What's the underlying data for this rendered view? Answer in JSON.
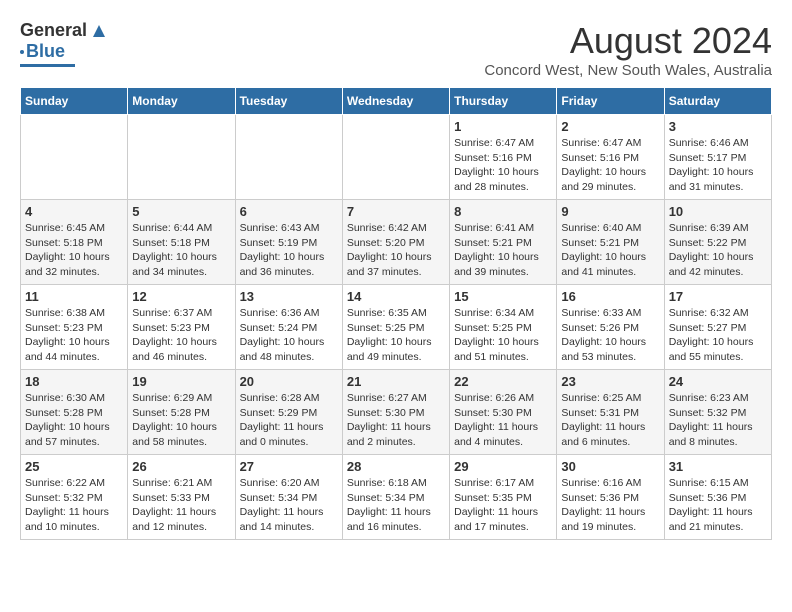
{
  "logo": {
    "general": "General",
    "blue": "Blue"
  },
  "title": {
    "month_year": "August 2024",
    "location": "Concord West, New South Wales, Australia"
  },
  "days_header": [
    "Sunday",
    "Monday",
    "Tuesday",
    "Wednesday",
    "Thursday",
    "Friday",
    "Saturday"
  ],
  "weeks": [
    [
      {
        "day": "",
        "info": ""
      },
      {
        "day": "",
        "info": ""
      },
      {
        "day": "",
        "info": ""
      },
      {
        "day": "",
        "info": ""
      },
      {
        "day": "1",
        "info": "Sunrise: 6:47 AM\nSunset: 5:16 PM\nDaylight: 10 hours\nand 28 minutes."
      },
      {
        "day": "2",
        "info": "Sunrise: 6:47 AM\nSunset: 5:16 PM\nDaylight: 10 hours\nand 29 minutes."
      },
      {
        "day": "3",
        "info": "Sunrise: 6:46 AM\nSunset: 5:17 PM\nDaylight: 10 hours\nand 31 minutes."
      }
    ],
    [
      {
        "day": "4",
        "info": "Sunrise: 6:45 AM\nSunset: 5:18 PM\nDaylight: 10 hours\nand 32 minutes."
      },
      {
        "day": "5",
        "info": "Sunrise: 6:44 AM\nSunset: 5:18 PM\nDaylight: 10 hours\nand 34 minutes."
      },
      {
        "day": "6",
        "info": "Sunrise: 6:43 AM\nSunset: 5:19 PM\nDaylight: 10 hours\nand 36 minutes."
      },
      {
        "day": "7",
        "info": "Sunrise: 6:42 AM\nSunset: 5:20 PM\nDaylight: 10 hours\nand 37 minutes."
      },
      {
        "day": "8",
        "info": "Sunrise: 6:41 AM\nSunset: 5:21 PM\nDaylight: 10 hours\nand 39 minutes."
      },
      {
        "day": "9",
        "info": "Sunrise: 6:40 AM\nSunset: 5:21 PM\nDaylight: 10 hours\nand 41 minutes."
      },
      {
        "day": "10",
        "info": "Sunrise: 6:39 AM\nSunset: 5:22 PM\nDaylight: 10 hours\nand 42 minutes."
      }
    ],
    [
      {
        "day": "11",
        "info": "Sunrise: 6:38 AM\nSunset: 5:23 PM\nDaylight: 10 hours\nand 44 minutes."
      },
      {
        "day": "12",
        "info": "Sunrise: 6:37 AM\nSunset: 5:23 PM\nDaylight: 10 hours\nand 46 minutes."
      },
      {
        "day": "13",
        "info": "Sunrise: 6:36 AM\nSunset: 5:24 PM\nDaylight: 10 hours\nand 48 minutes."
      },
      {
        "day": "14",
        "info": "Sunrise: 6:35 AM\nSunset: 5:25 PM\nDaylight: 10 hours\nand 49 minutes."
      },
      {
        "day": "15",
        "info": "Sunrise: 6:34 AM\nSunset: 5:25 PM\nDaylight: 10 hours\nand 51 minutes."
      },
      {
        "day": "16",
        "info": "Sunrise: 6:33 AM\nSunset: 5:26 PM\nDaylight: 10 hours\nand 53 minutes."
      },
      {
        "day": "17",
        "info": "Sunrise: 6:32 AM\nSunset: 5:27 PM\nDaylight: 10 hours\nand 55 minutes."
      }
    ],
    [
      {
        "day": "18",
        "info": "Sunrise: 6:30 AM\nSunset: 5:28 PM\nDaylight: 10 hours\nand 57 minutes."
      },
      {
        "day": "19",
        "info": "Sunrise: 6:29 AM\nSunset: 5:28 PM\nDaylight: 10 hours\nand 58 minutes."
      },
      {
        "day": "20",
        "info": "Sunrise: 6:28 AM\nSunset: 5:29 PM\nDaylight: 11 hours\nand 0 minutes."
      },
      {
        "day": "21",
        "info": "Sunrise: 6:27 AM\nSunset: 5:30 PM\nDaylight: 11 hours\nand 2 minutes."
      },
      {
        "day": "22",
        "info": "Sunrise: 6:26 AM\nSunset: 5:30 PM\nDaylight: 11 hours\nand 4 minutes."
      },
      {
        "day": "23",
        "info": "Sunrise: 6:25 AM\nSunset: 5:31 PM\nDaylight: 11 hours\nand 6 minutes."
      },
      {
        "day": "24",
        "info": "Sunrise: 6:23 AM\nSunset: 5:32 PM\nDaylight: 11 hours\nand 8 minutes."
      }
    ],
    [
      {
        "day": "25",
        "info": "Sunrise: 6:22 AM\nSunset: 5:32 PM\nDaylight: 11 hours\nand 10 minutes."
      },
      {
        "day": "26",
        "info": "Sunrise: 6:21 AM\nSunset: 5:33 PM\nDaylight: 11 hours\nand 12 minutes."
      },
      {
        "day": "27",
        "info": "Sunrise: 6:20 AM\nSunset: 5:34 PM\nDaylight: 11 hours\nand 14 minutes."
      },
      {
        "day": "28",
        "info": "Sunrise: 6:18 AM\nSunset: 5:34 PM\nDaylight: 11 hours\nand 16 minutes."
      },
      {
        "day": "29",
        "info": "Sunrise: 6:17 AM\nSunset: 5:35 PM\nDaylight: 11 hours\nand 17 minutes."
      },
      {
        "day": "30",
        "info": "Sunrise: 6:16 AM\nSunset: 5:36 PM\nDaylight: 11 hours\nand 19 minutes."
      },
      {
        "day": "31",
        "info": "Sunrise: 6:15 AM\nSunset: 5:36 PM\nDaylight: 11 hours\nand 21 minutes."
      }
    ]
  ]
}
